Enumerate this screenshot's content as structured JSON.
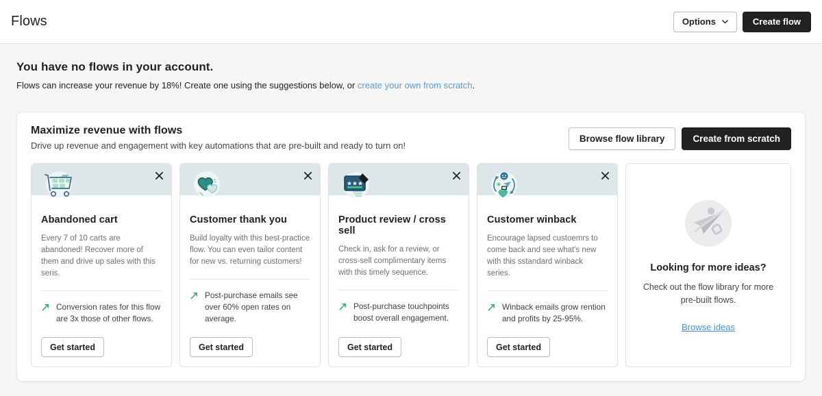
{
  "header": {
    "title": "Flows",
    "options_label": "Options",
    "create_flow_label": "Create flow"
  },
  "empty_state": {
    "title": "You have no flows in your account.",
    "description_prefix": "Flows can increase your revenue by 18%! Create one using the suggestions below, or ",
    "link_text": "create your own from scratch",
    "description_suffix": "."
  },
  "panel": {
    "title": "Maximize revenue with flows",
    "subtitle": "Drive up revenue and engagement with key automations that are pre-built and ready to turn on!",
    "browse_label": "Browse flow library",
    "create_label": "Create from scratch"
  },
  "cards": [
    {
      "icon": "shopping-cart-icon",
      "title": "Abandoned cart",
      "description": "Every 7 of 10 carts are abandoned! Recover more of them and drive up sales with this seris.",
      "stat": "Conversion rates for this flow are 3x those of other flows.",
      "cta": "Get started"
    },
    {
      "icon": "heart-icon",
      "title": "Customer thank you",
      "description": "Build loyalty with this best-practice flow. You can even tailor content for new vs. returning customers!",
      "stat": "Post-purchase emails see over 60% open rates on average.",
      "cta": "Get started"
    },
    {
      "icon": "review-stars-icon",
      "title": "Product review / cross sell",
      "description": "Check in, ask for a review, or cross-sell complimentary items with this timely sequence.",
      "stat": "Post-purchase touchpoints boost overall engagement.",
      "cta": "Get started"
    },
    {
      "icon": "customer-cycle-icon",
      "title": "Customer winback",
      "description": "Encourage lapsed custoemrs to come back and see what's new with this sstandard winback series.",
      "stat": "Winback emails grow rention and profits by 25-95%.",
      "cta": "Get started"
    }
  ],
  "ideas_card": {
    "title": "Looking for more ideas?",
    "description": "Check out the flow library for more pre-built flows.",
    "link": "Browse ideas"
  },
  "colors": {
    "page_background": "#f6f6f7",
    "card_band": "#dde6e9",
    "primary_button": "#202223",
    "link": "#5c9bd6",
    "stat_arrow": "#3fa97a",
    "teal_accent": "#2c7a7b"
  }
}
